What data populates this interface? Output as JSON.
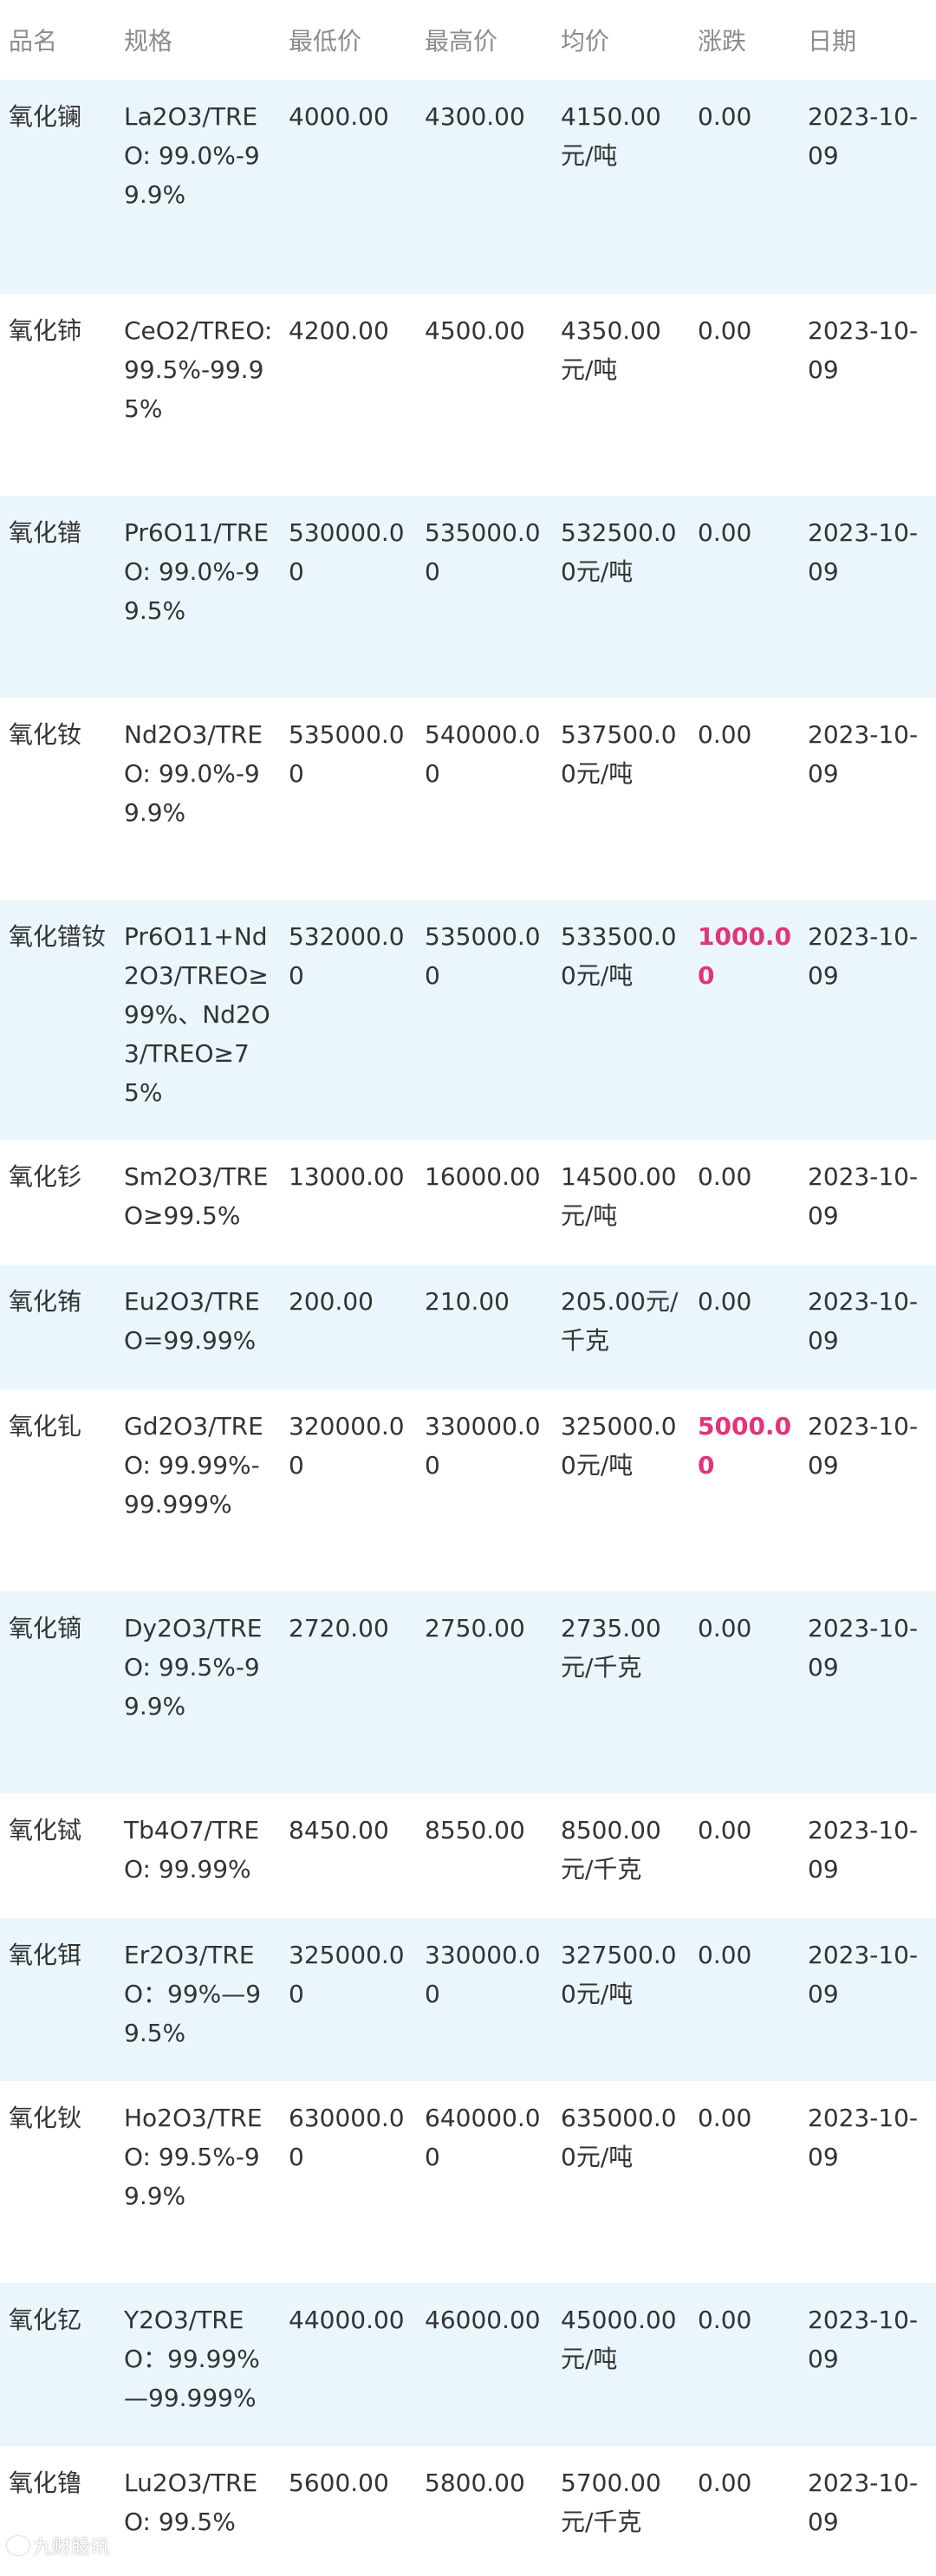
{
  "table": {
    "headers": [
      "品名",
      "规格",
      "最低价",
      "最高价",
      "均价",
      "涨跌",
      "日期"
    ],
    "rows": [
      {
        "name": "氧化镧",
        "spec": "La2O3/TREO: 99.0%-99.9%",
        "low": "4000.00",
        "high": "4300.00",
        "avg": "4150.00元/吨",
        "change": "0.00",
        "up": false,
        "date": "2023-10-09"
      },
      {
        "name": "氧化铈",
        "spec": "CeO2/TREO: 99.5%-99.95%",
        "low": "4200.00",
        "high": "4500.00",
        "avg": "4350.00元/吨",
        "change": "0.00",
        "up": false,
        "date": "2023-10-09"
      },
      {
        "name": "氧化镨",
        "spec": "Pr6O11/TREO: 99.0%-99.5%",
        "low": "530000.00",
        "high": "535000.00",
        "avg": "532500.00元/吨",
        "change": "0.00",
        "up": false,
        "date": "2023-10-09"
      },
      {
        "name": "氧化钕",
        "spec": "Nd2O3/TREO: 99.0%-99.9%",
        "low": "535000.00",
        "high": "540000.00",
        "avg": "537500.00元/吨",
        "change": "0.00",
        "up": false,
        "date": "2023-10-09"
      },
      {
        "name": "氧化镨钕",
        "spec": "Pr6O11+Nd2O3/TREO≥99%、Nd2O3/TREO≥75%",
        "low": "532000.00",
        "high": "535000.00",
        "avg": "533500.00元/吨",
        "change": "1000.00",
        "up": true,
        "date": "2023-10-09"
      },
      {
        "name": "氧化钐",
        "spec": "Sm2O3/TREO≥99.5%",
        "low": "13000.00",
        "high": "16000.00",
        "avg": "14500.00元/吨",
        "change": "0.00",
        "up": false,
        "date": "2023-10-09"
      },
      {
        "name": "氧化铕",
        "spec": "Eu2O3/TREO=99.99%",
        "low": "200.00",
        "high": "210.00",
        "avg": "205.00元/千克",
        "change": "0.00",
        "up": false,
        "date": "2023-10-09"
      },
      {
        "name": "氧化钆",
        "spec": "Gd2O3/TREO: 99.99%-99.999%",
        "low": "320000.00",
        "high": "330000.00",
        "avg": "325000.00元/吨",
        "change": "5000.00",
        "up": true,
        "date": "2023-10-09"
      },
      {
        "name": "氧化镝",
        "spec": "Dy2O3/TREO: 99.5%-99.9%",
        "low": "2720.00",
        "high": "2750.00",
        "avg": "2735.00元/千克",
        "change": "0.00",
        "up": false,
        "date": "2023-10-09"
      },
      {
        "name": "氧化铽",
        "spec": "Tb4O7/TREO: 99.99%",
        "low": "8450.00",
        "high": "8550.00",
        "avg": "8500.00元/千克",
        "change": "0.00",
        "up": false,
        "date": "2023-10-09"
      },
      {
        "name": "氧化铒",
        "spec": "Er2O3/TREO：99%—99.5%",
        "low": "325000.00",
        "high": "330000.00",
        "avg": "327500.00元/吨",
        "change": "0.00",
        "up": false,
        "date": "2023-10-09"
      },
      {
        "name": "氧化钬",
        "spec": "Ho2O3/TREO: 99.5%-99.9%",
        "low": "630000.00",
        "high": "640000.00",
        "avg": "635000.00元/吨",
        "change": "0.00",
        "up": false,
        "date": "2023-10-09"
      },
      {
        "name": "氧化钇",
        "spec": "Y2O3/TREO：99.99%—99.999%",
        "low": "44000.00",
        "high": "46000.00",
        "avg": "45000.00元/吨",
        "change": "0.00",
        "up": false,
        "date": "2023-10-09"
      },
      {
        "name": "氧化镥",
        "spec": "Lu2O3/TREO: 99.5%",
        "low": "5600.00",
        "high": "5800.00",
        "avg": "5700.00元/千克",
        "change": "0.00",
        "up": false,
        "date": "2023-10-09"
      }
    ]
  },
  "watermark": {
    "text": "九财股讯"
  },
  "colors": {
    "row_highlight": "#eaf6fc",
    "header_text": "#8c8c8c",
    "up_change": "#e0357a"
  }
}
